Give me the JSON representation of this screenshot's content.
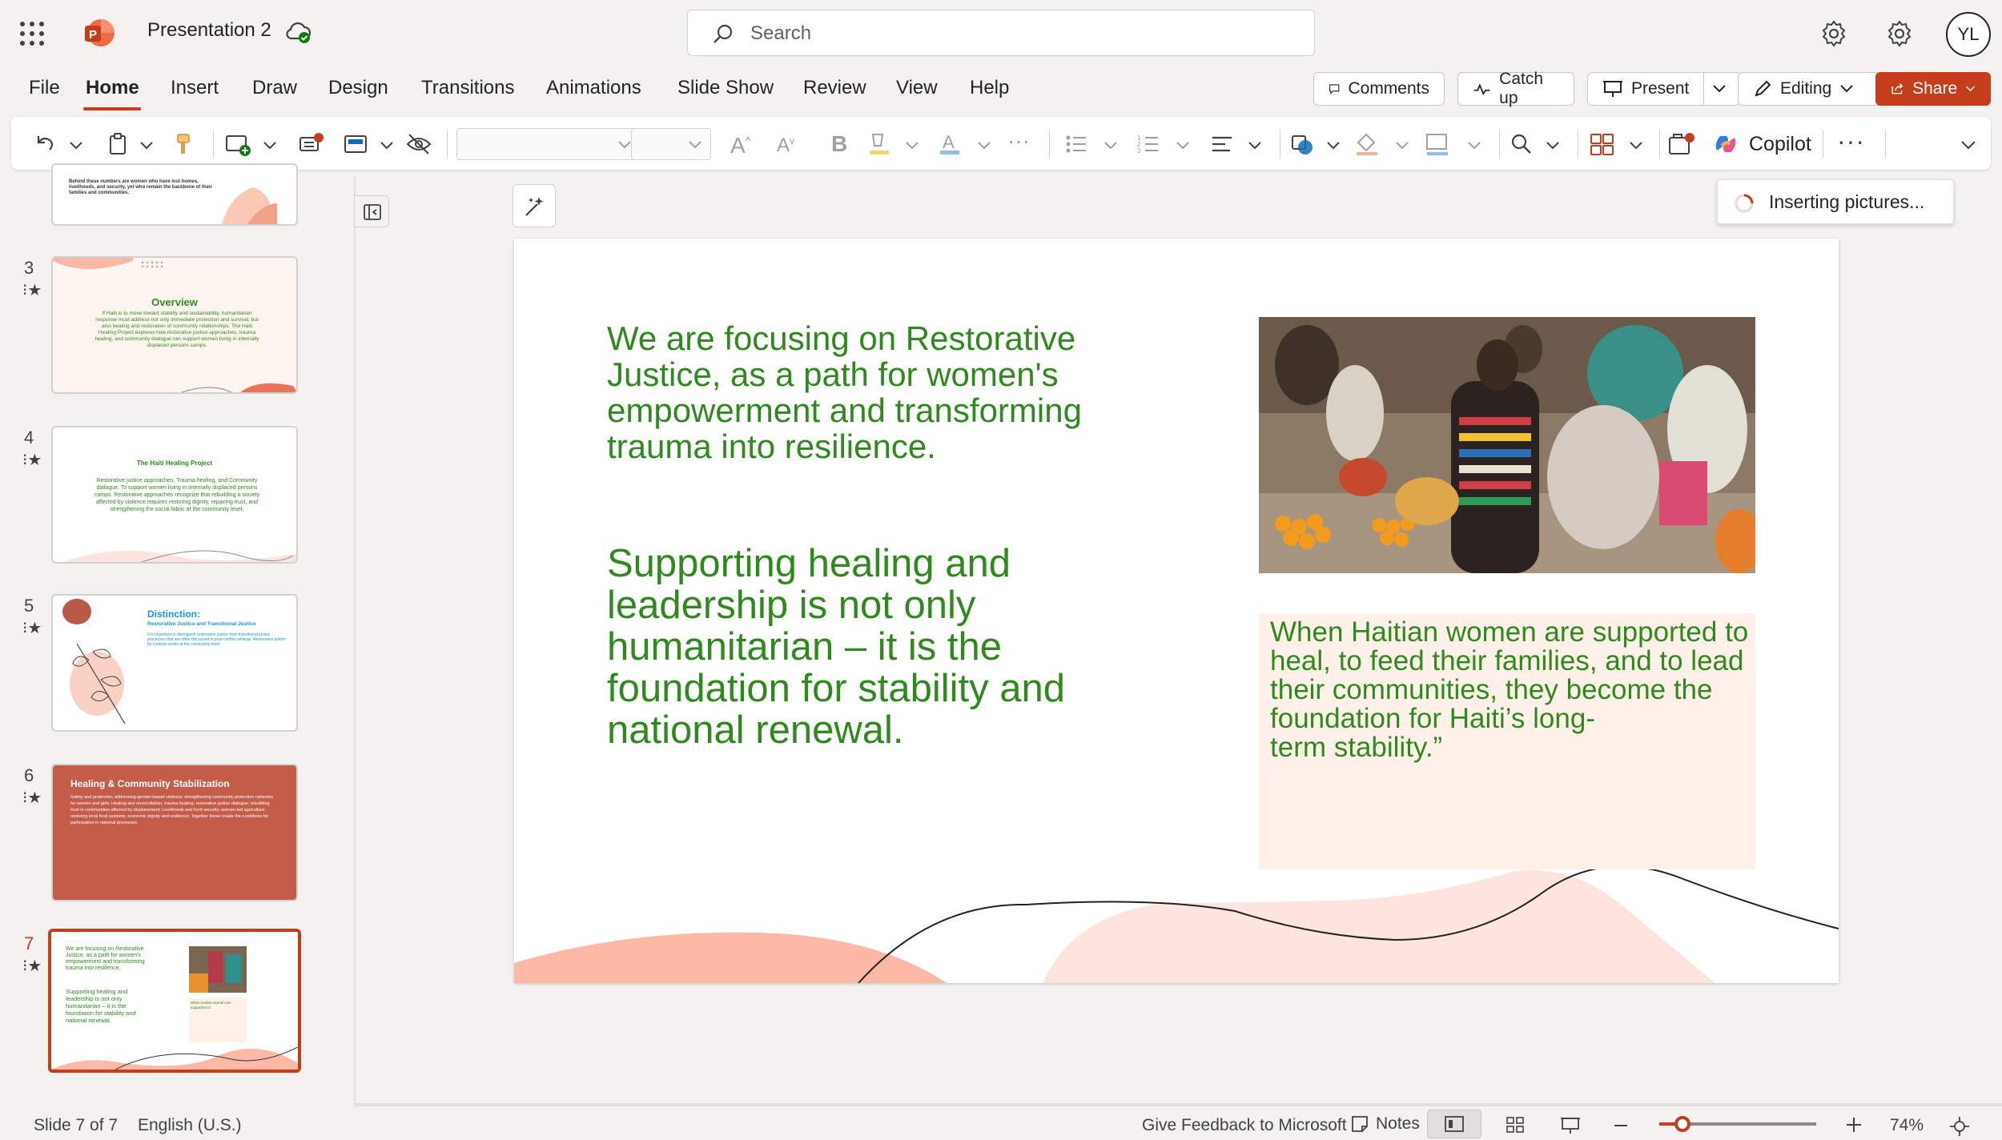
{
  "app": {
    "title": "Presentation 2",
    "search_placeholder": "Search",
    "avatar_initials": "YL",
    "accent_color": "#c43e1c"
  },
  "menu": {
    "tabs": [
      "File",
      "Home",
      "Insert",
      "Draw",
      "Design",
      "Transitions",
      "Animations",
      "Slide Show",
      "Review",
      "View",
      "Help"
    ],
    "active_tab": "Home",
    "buttons": {
      "comments": "Comments",
      "catch_up": "Catch up",
      "present": "Present",
      "editing": "Editing",
      "share": "Share"
    }
  },
  "ribbon": {
    "copilot_label": "Copilot",
    "icons": [
      "undo-icon",
      "paste-icon",
      "format-painter-icon",
      "new-slide-icon",
      "reuse-slides-icon",
      "layout-icon",
      "hide-slide-icon",
      "font-family-dropdown",
      "font-size-dropdown",
      "increase-font-icon",
      "decrease-font-icon",
      "bold-icon",
      "highlight-icon",
      "font-color-icon",
      "more-font-options-icon",
      "bullets-icon",
      "numbering-icon",
      "align-icon",
      "shapes-icon",
      "shape-fill-icon",
      "shape-outline-icon",
      "find-icon",
      "designer-icon",
      "add-in-icon",
      "copilot-icon",
      "more-options-icon",
      "expand-ribbon-icon"
    ]
  },
  "thumbnails": {
    "items": [
      {
        "number": "",
        "title": "",
        "text": "Behind these numbers are women who have lost homes, livelihoods, and security, yet who remain the backbone of their families and communities."
      },
      {
        "number": "3",
        "title": "Overview",
        "text": "If Haiti is to move toward stability and sustainability, humanitarian response must address not only immediate protection and survival, but also healing and restoration of community relationships. The Haiti Healing Project explores how restorative justice approaches, trauma healing, and community dialogue can support women living in internally displaced persons camps."
      },
      {
        "number": "4",
        "title": "The Haiti Healing Project",
        "text": "Restorative justice approaches, Trauma healing, and Community dialogue. To support women living in internally displaced persons camps. Restorative approaches recognize that rebuilding a society affected by violence requires restoring dignity, repairing trust, and strengthening the social fabric at the community level."
      },
      {
        "number": "5",
        "title": "Distinction:",
        "subtitle": "Restorative Justice and Transitional Justice",
        "text": "It is important to distinguish restorative justice from transitional justice processes that are often discussed in post-conflict settings. Restorative justice by contrast works at the community level."
      },
      {
        "number": "6",
        "title": "Healing & Community Stabilization",
        "text": "Safety and protection; addressing gender-based violence; strengthening community protection networks for women and girls; Healing and reconciliation; trauma healing; restorative justice dialogue; rebuilding trust in communities affected by displacement; Livelihoods and food security; women-led agriculture; restoring local food systems; economic dignity and resilience; Together these create the conditions for participation in national processes."
      },
      {
        "number": "7",
        "title": "",
        "text": "We are focusing on Restorative Justice, as a path for women's empowerment and transforming trauma into resilience."
      }
    ]
  },
  "slide": {
    "text1": "We are focusing on Restorative Justice, as a path for women's empowerment and transforming trauma into resilience.",
    "text2": "Supporting healing and leadership is not only humanitarian – it is the foundation for stability and national renewal.",
    "quote_lines": [
      "When Haitian women are supported to",
      "heal, to feed their families, and to lead",
      "their communities, they become the",
      "foundation for Haiti’s long-",
      "term stability.”"
    ],
    "text_color": "#2f8a1e",
    "quote_bg": "#fff0ea",
    "wave_color": "#fdb8a6"
  },
  "toast": {
    "text": "Inserting pictures..."
  },
  "status": {
    "slide_counter": "Slide 7 of 7",
    "language": "English (U.S.)",
    "feedback": "Give Feedback to Microsoft",
    "notes": "Notes",
    "zoom": "74%",
    "zoom_level_fraction": 0.15
  }
}
